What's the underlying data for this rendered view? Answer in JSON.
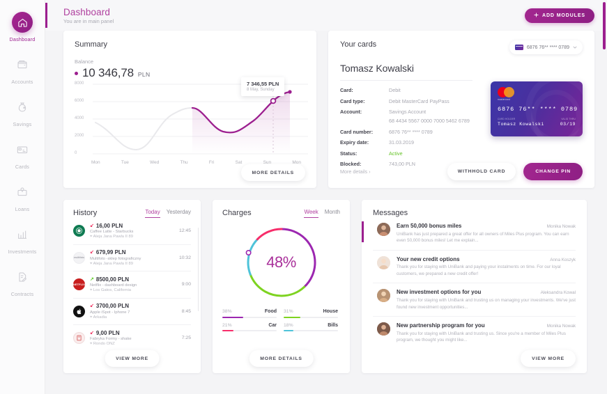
{
  "sidebar": {
    "items": [
      {
        "label": "Dashboard",
        "icon": "home-icon",
        "active": true
      },
      {
        "label": "Accounts",
        "icon": "wallet-icon",
        "active": false
      },
      {
        "label": "Savings",
        "icon": "money-bag-icon",
        "active": false
      },
      {
        "label": "Cards",
        "icon": "credit-card-icon",
        "active": false
      },
      {
        "label": "Loans",
        "icon": "loan-icon",
        "active": false
      },
      {
        "label": "Investments",
        "icon": "bar-chart-icon",
        "active": false
      },
      {
        "label": "Contracts",
        "icon": "document-edit-icon",
        "active": false
      }
    ]
  },
  "header": {
    "title": "Dashboard",
    "subtitle": "You are in main panel",
    "add_modules_label": "ADD MODULES",
    "add_modules_icon": "plus-icon"
  },
  "summary": {
    "title": "Summary",
    "balance_label": "Balance",
    "balance_amount": "10 346,78",
    "balance_currency": "PLN",
    "tooltip_amount": "7 346,55 PLN",
    "tooltip_date": "8 May, Sunday",
    "more_details_label": "MORE DETAILS",
    "accent": "#9c1f8f"
  },
  "cards_panel": {
    "title": "Your cards",
    "selector_value": "6876 76** **** 0789",
    "selector_icon": "chevron-down-icon",
    "holder_name": "Tomasz Kowalski",
    "details": [
      {
        "key": "Card:",
        "value": "Debit"
      },
      {
        "key": "Card type:",
        "value": "Debit MasterCard PayPass"
      },
      {
        "key": "Account:",
        "value": "Savings Account"
      },
      {
        "key": "Card number:",
        "value": "6876 76** **** 0789"
      },
      {
        "key": "Expiry date:",
        "value": "31.03.2019"
      },
      {
        "key": "Status:",
        "value": "Active"
      },
      {
        "key": "Blocked:",
        "value": "743,00 PLN"
      }
    ],
    "account_number": "68 4434 5567 0000 7000 5462 6789",
    "status_color": "#66c328",
    "credit_card": {
      "brand": "mastercard",
      "number": "6876  76**  ****  0789",
      "holder_label": "CARD HOLDER",
      "holder_value": "Tomasz Kowalski",
      "valid_label": "VALID THRU",
      "valid_value": "03/19"
    },
    "more_details_link": "More details ›",
    "withhold_label": "WITHHOLD CARD",
    "change_pin_label": "CHANGE PIN"
  },
  "history": {
    "title": "History",
    "tabs": [
      {
        "label": "Today",
        "active": true
      },
      {
        "label": "Yesterday",
        "active": false
      }
    ],
    "transactions": [
      {
        "amount": "16,00 PLN",
        "direction": "out",
        "desc": "Caffee Latte - Starbucks",
        "location": "Aleja Jana Pawla II 89",
        "time": "12:45",
        "logo": "starbucks-logo",
        "logo_color": "#0f7b52"
      },
      {
        "amount": "679,99 PLN",
        "direction": "out",
        "desc": "Multifoto -sklep fotograficzny",
        "location": "Aleja Jana Pawla II 89",
        "time": "10:32",
        "logo": "multifoto-logo",
        "logo_color": "#f3f3f5"
      },
      {
        "amount": "8500,00 PLN",
        "direction": "in",
        "desc": "Netflix - dashboard design",
        "location": "Los Gatos, California",
        "time": "9:00",
        "logo": "netflix-logo",
        "logo_color": "#c81f1f"
      },
      {
        "amount": "3700,00 PLN",
        "direction": "out",
        "desc": "Apple iSpot - Iphone 7",
        "location": "Arkadia",
        "time": "8:45",
        "logo": "apple-logo",
        "logo_color": "#111111"
      },
      {
        "amount": "9,00 PLN",
        "direction": "out",
        "desc": "Fabryka Formy - shake",
        "location": "Rondo ONZ",
        "time": "7:25",
        "logo": "fabryka-formy-logo",
        "logo_color": "#f5eaea"
      }
    ],
    "view_more_label": "VIEW MORE"
  },
  "charges": {
    "title": "Charges",
    "tabs": [
      {
        "label": "Week",
        "active": true
      },
      {
        "label": "Month",
        "active": false
      }
    ],
    "center_value": "48%",
    "more_details_label": "MORE DETAILS"
  },
  "chart_data": [
    {
      "type": "line",
      "title": "Summary",
      "xlabel": "",
      "ylabel": "",
      "categories": [
        "Mon",
        "Tue",
        "Wed",
        "Thu",
        "Fri",
        "Sat",
        "Sun",
        "Mon"
      ],
      "values": [
        3600,
        1950,
        3400,
        5300,
        4600,
        3900,
        5500,
        8550
      ],
      "ylim": [
        0,
        8000
      ],
      "yticks": [
        0,
        2000,
        4000,
        6000,
        8000
      ],
      "grid": true,
      "highlight_point": {
        "x": "Sun+",
        "y": 6900,
        "label": "7 346,55 PLN",
        "sublabel": "8 May, Sunday"
      },
      "series_color": "#9c1f8f",
      "past_color": "#ececed",
      "legend": false
    },
    {
      "type": "pie",
      "title": "Charges",
      "center_label": "48%",
      "categories": [
        "Food",
        "House",
        "Car",
        "Bills"
      ],
      "values": [
        38,
        31,
        21,
        18
      ],
      "colors": [
        "#9c27b0",
        "#7ed321",
        "#f72d6a",
        "#4ec3d9"
      ],
      "legend": true,
      "legend_position": "bottom",
      "unit": "%"
    }
  ],
  "messages": {
    "title": "Messages",
    "items": [
      {
        "title": "Earn 50,000 bonus miles",
        "author": "Monika Nowak",
        "text": "UniBank has just prepared a great offer for all owners of Miles Plus program. You can earn even 50,000 bonus miles! Let me explain...",
        "unread": true,
        "avatar": "avatar-monika-nowak",
        "avatar_color": "#8d6a58"
      },
      {
        "title": "Your new credit options",
        "author": "Anna Koszyk",
        "text": "Thank you for staying with UniBank and paying your instalments on time. For our loyal customers, we prepared a new credit offer!",
        "unread": false,
        "avatar": "avatar-anna-koszyk",
        "avatar_color": "#e8cfc2"
      },
      {
        "title": "New investment options for you",
        "author": "Aleksandra Kowal",
        "text": "Thank you for staying with UniBank and trusting us on managing your investments. We've just found new investment opportunities...",
        "unread": false,
        "avatar": "avatar-aleksandra-kowal",
        "avatar_color": "#b89373"
      },
      {
        "title": "New partnership program for you",
        "author": "Monika Nowak",
        "text": "Thank you for staying with UniBank and trusting us. Since you're a member of Miles Plus program, we thought you might like...",
        "unread": false,
        "avatar": "avatar-monika-nowak-2",
        "avatar_color": "#7d5a4a"
      }
    ],
    "view_more_label": "VIEW MORE"
  }
}
